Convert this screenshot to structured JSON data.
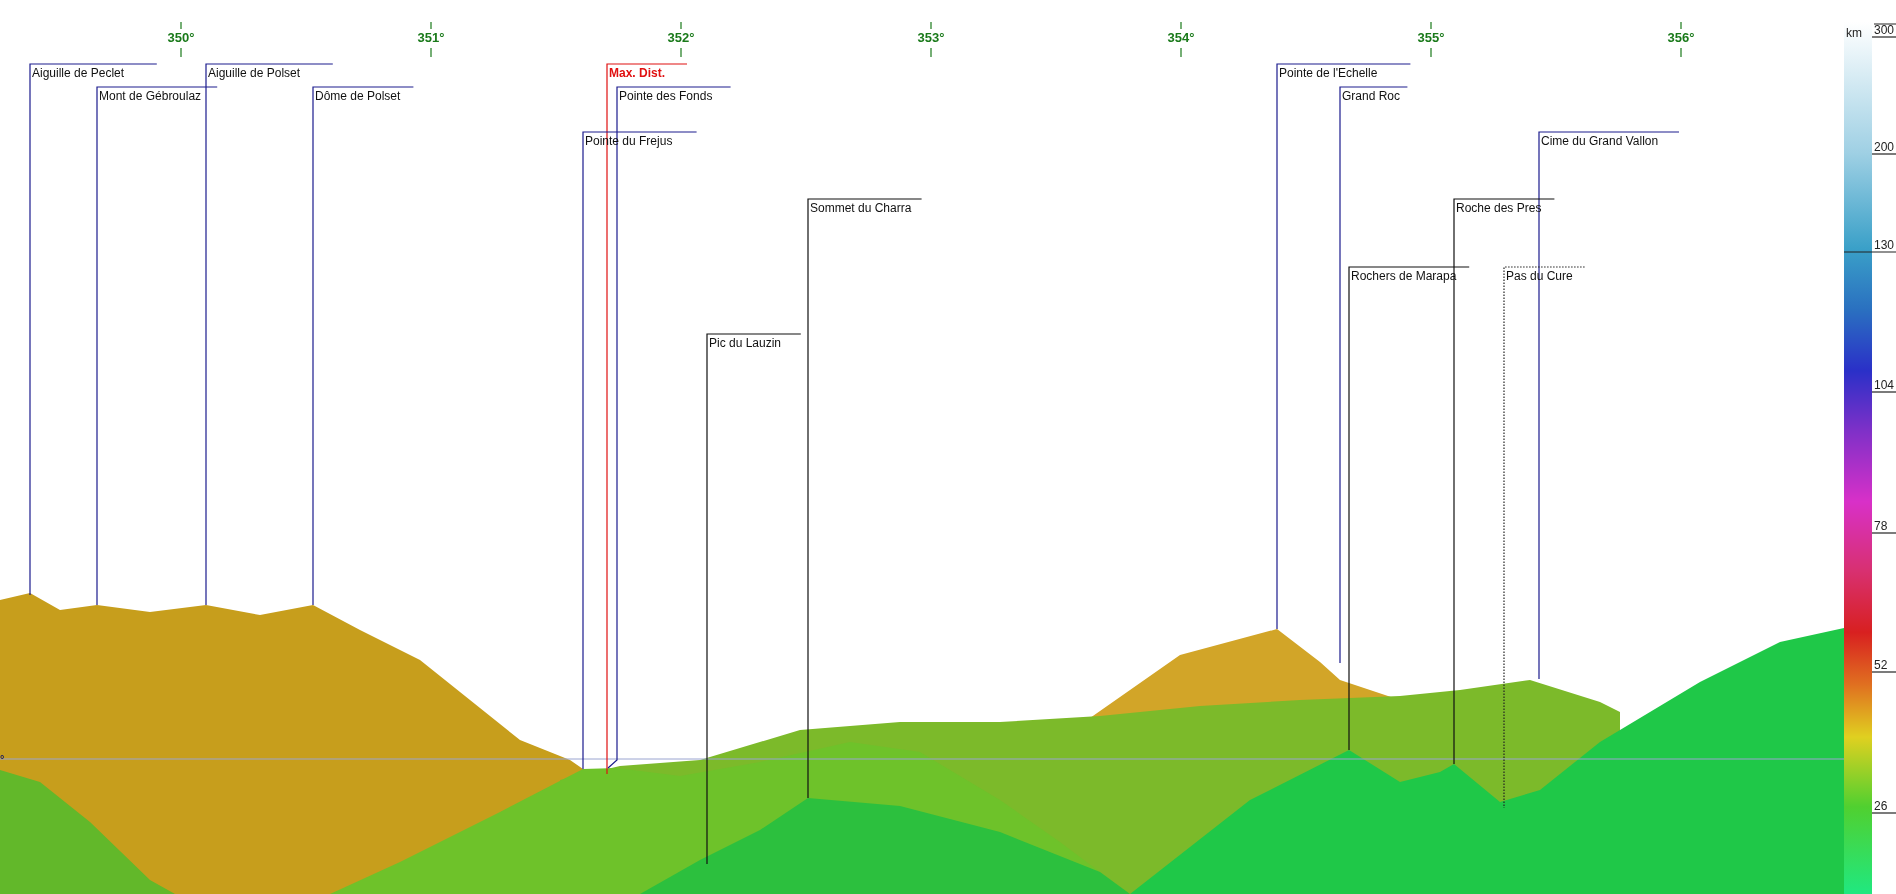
{
  "azimuth_ticks": [
    "350°",
    "351°",
    "352°",
    "353°",
    "354°",
    "355°",
    "356°"
  ],
  "horizon_label": "°",
  "peaks": [
    {
      "name": "Aiguille de Peclet",
      "kind": "distant"
    },
    {
      "name": "Mont de Gébroulaz",
      "kind": "distant"
    },
    {
      "name": "Aiguille de Polset",
      "kind": "distant"
    },
    {
      "name": "Dôme de Polset",
      "kind": "distant"
    },
    {
      "name": "Max. Dist.",
      "kind": "limit"
    },
    {
      "name": "Pointe des Fonds",
      "kind": "distant"
    },
    {
      "name": "Pointe du Frejus",
      "kind": "distant"
    },
    {
      "name": "Sommet du Charra",
      "kind": "near"
    },
    {
      "name": "Pic du Lauzin",
      "kind": "near"
    },
    {
      "name": "Pointe de l'Echelle",
      "kind": "distant"
    },
    {
      "name": "Grand Roc",
      "kind": "distant"
    },
    {
      "name": "Cime du Grand Vallon",
      "kind": "distant"
    },
    {
      "name": "Roche des Pres",
      "kind": "near"
    },
    {
      "name": "Rochers de Marapa",
      "kind": "near"
    },
    {
      "name": "Pas du Cure",
      "kind": "hidden"
    }
  ],
  "distance_scale": {
    "unit": "km",
    "ticks": [
      "300",
      "200",
      "130",
      "104",
      "78",
      "52",
      "26"
    ]
  }
}
